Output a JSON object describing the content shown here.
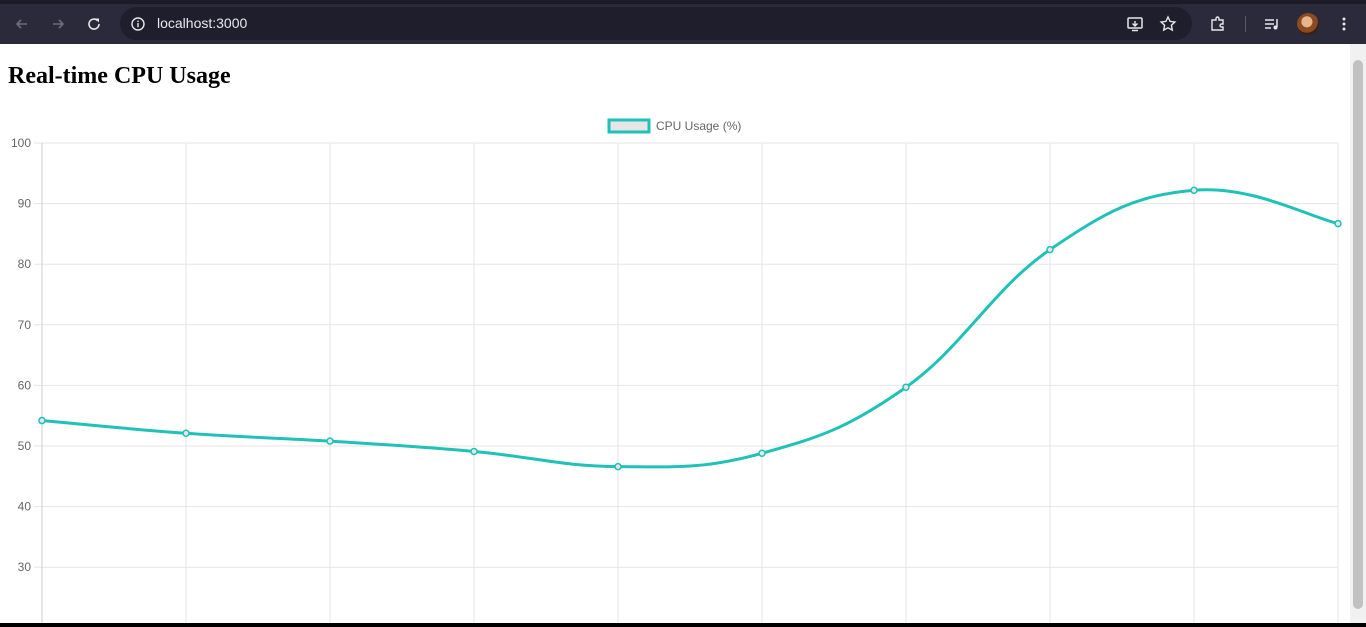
{
  "browser": {
    "url": "localhost:3000",
    "icons": [
      "back-icon",
      "forward-icon",
      "reload-icon",
      "site-info-icon",
      "install-app-icon",
      "bookmark-star-icon",
      "extensions-icon",
      "media-control-icon",
      "avatar",
      "menu-icon"
    ]
  },
  "page": {
    "title": "Real-time CPU Usage"
  },
  "chart_data": {
    "type": "line",
    "title": "",
    "xlabel": "",
    "ylabel": "",
    "x_tick_labels_visible": false,
    "ylim": [
      22,
      100
    ],
    "yticks": [
      30,
      40,
      50,
      60,
      70,
      80,
      90,
      100
    ],
    "legend_position": "top-center",
    "grid": true,
    "series": [
      {
        "name": "CPU Usage (%)",
        "color": "#1fc1b9",
        "fill": "#e6e6e6",
        "values": [
          54.2,
          52.1,
          50.8,
          49.1,
          46.6,
          48.8,
          59.7,
          82.4,
          92.2,
          86.7
        ]
      }
    ]
  }
}
